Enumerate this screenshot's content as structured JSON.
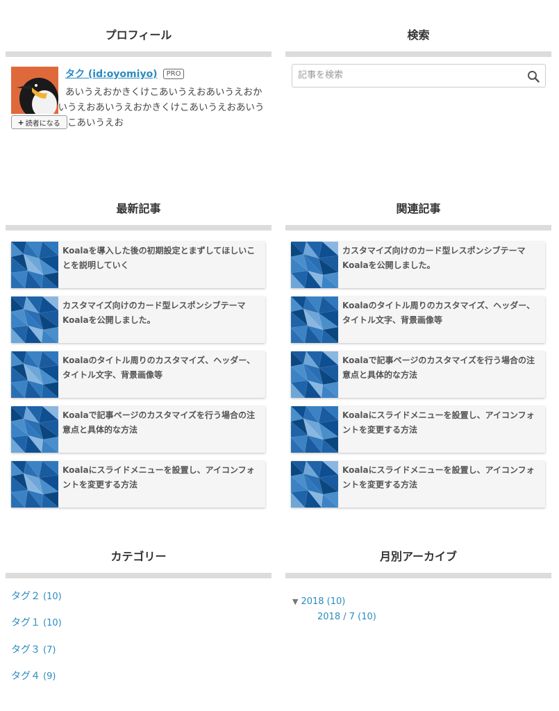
{
  "profile": {
    "title": "プロフィール",
    "name": "タク (id:oyomiyo)",
    "badge": "PRO",
    "bio": "あいうえおかきくけこあいうえおあいうえおかきくけこあいうえおあいうえおかきくけこあいうえおあいうえおかきくけこあいうえお",
    "subscribe_label": "読者になる"
  },
  "search": {
    "title": "検索",
    "placeholder": "記事を検索"
  },
  "recent": {
    "title": "最新記事",
    "items": [
      "Koalaを導入した後の初期設定とまずしてほしいことを説明していく",
      "カスタマイズ向けのカード型レスポンシブテーマKoalaを公開しました。",
      "Koalaのタイトル周りのカスタマイズ、ヘッダー、タイトル文字、背景画像等",
      "Koalaで記事ページのカスタマイズを行う場合の注意点と具体的な方法",
      "Koalaにスライドメニューを設置し、アイコンフォントを変更する方法"
    ]
  },
  "related": {
    "title": "関連記事",
    "items": [
      "カスタマイズ向けのカード型レスポンシブテーマKoalaを公開しました。",
      "Koalaのタイトル周りのカスタマイズ、ヘッダー、タイトル文字、背景画像等",
      "Koalaで記事ページのカスタマイズを行う場合の注意点と具体的な方法",
      "Koalaにスライドメニューを設置し、アイコンフォントを変更する方法",
      "Koalaにスライドメニューを設置し、アイコンフォントを変更する方法"
    ]
  },
  "categories": {
    "title": "カテゴリー",
    "items": [
      {
        "label": "タグ２",
        "count": "(10)"
      },
      {
        "label": "タグ１",
        "count": "(10)"
      },
      {
        "label": "タグ３",
        "count": "(7)"
      },
      {
        "label": "タグ４",
        "count": "(9)"
      }
    ]
  },
  "archive": {
    "title": "月別アーカイブ",
    "year": "2018 (10)",
    "month": "2018 / 7 (10)"
  },
  "colors": {
    "link": "#2a8bbf",
    "rule": "#dcdcdc",
    "card_bg": "#f5f5f5",
    "avatar_bg": "#e0693b",
    "thumb_blue": "#1f64a8"
  }
}
